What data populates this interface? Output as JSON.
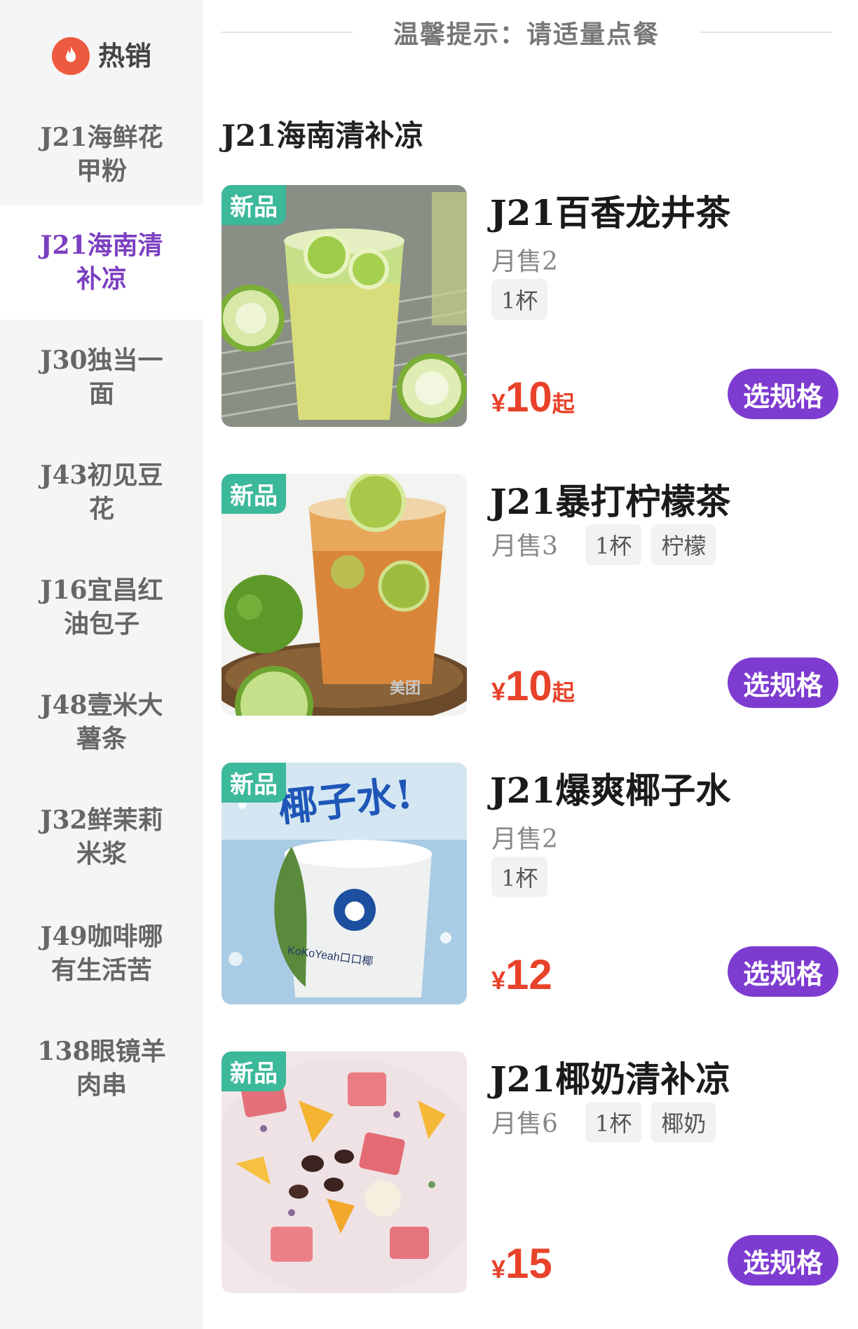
{
  "sidebar": {
    "hot_label": "热销",
    "items": [
      {
        "label": "J21海鲜花甲粉"
      },
      {
        "label": "J21海南清补凉"
      },
      {
        "label": "J30独当一面"
      },
      {
        "label": "J43初见豆花"
      },
      {
        "label": "J16宜昌红油包子"
      },
      {
        "label": "J48壹米大薯条"
      },
      {
        "label": "J32鲜茉莉米浆"
      },
      {
        "label": "J49咖啡哪有生活苦"
      },
      {
        "label": "138眼镜羊肉串"
      }
    ],
    "active_index": 1
  },
  "notice": "温馨提示：请适量点餐",
  "section_title": "J21海南清补凉",
  "products": [
    {
      "badge": "新品",
      "name": "J21百香龙井茶",
      "sales": "月售2",
      "tags": [
        "1杯"
      ],
      "price_symbol": "¥",
      "price": "10",
      "price_suffix": "起",
      "button": "选规格"
    },
    {
      "badge": "新品",
      "name": "J21暴打柠檬茶",
      "sales": "月售3",
      "tags": [
        "1杯",
        "柠檬"
      ],
      "price_symbol": "¥",
      "price": "10",
      "price_suffix": "起",
      "button": "选规格"
    },
    {
      "badge": "新品",
      "name": "J21爆爽椰子水",
      "sales": "月售2",
      "tags": [
        "1杯"
      ],
      "price_symbol": "¥",
      "price": "12",
      "price_suffix": "",
      "button": "选规格"
    },
    {
      "badge": "新品",
      "name": "J21椰奶清补凉",
      "sales": "月售6",
      "tags": [
        "1杯",
        "椰奶"
      ],
      "price_symbol": "¥",
      "price": "15",
      "price_suffix": "",
      "button": "选规格"
    }
  ],
  "image_text": {
    "p2_watermark": "美团",
    "p3_banner": "椰子水!",
    "p3_brand": "KoKoYeah口口椰"
  },
  "colors": {
    "accent_purple": "#7e3bd0",
    "price_red": "#e8422a",
    "badge_green": "#3cb89a",
    "sidebar_bg": "#f5f5f7"
  }
}
